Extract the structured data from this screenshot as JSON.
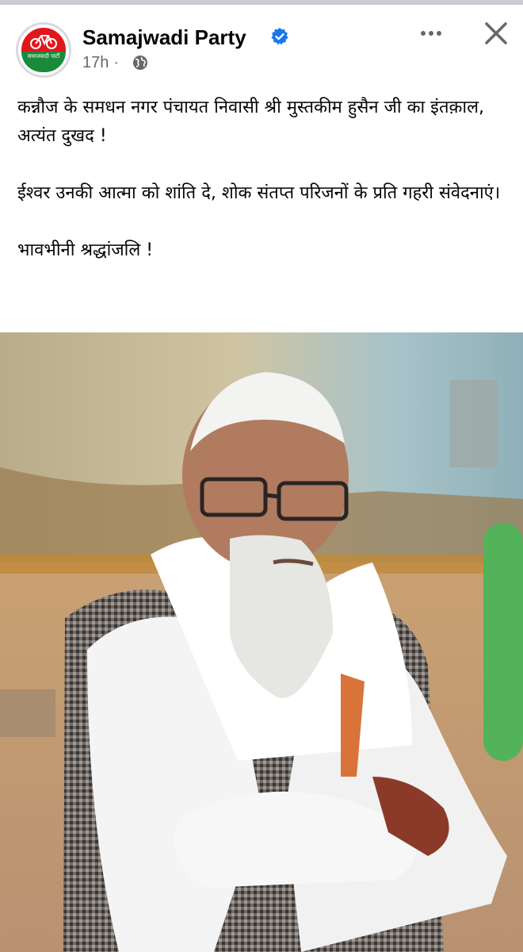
{
  "post": {
    "page_name": "Samajwadi Party",
    "avatar_label": "समाजवादी पार्टी",
    "time_ago": "17h",
    "dot": "·",
    "paragraphs": [
      "कन्नौज के समधन नगर पंचायत निवासी श्री मुस्तकीम हुसैन जी का इंतक़ाल, अत्यंत दुखद !",
      "ईश्वर उनकी आत्मा को शांति दे, शोक संतप्त परिजनों के प्रति गहरी संवेदनाएं।",
      "भावभीनी श्रद्धांजलि !"
    ]
  },
  "icons": {
    "verified": "verified-badge-icon",
    "audience": "globe-icon",
    "more": "more-options-icon",
    "close": "close-icon"
  },
  "colors": {
    "verified_blue": "#1877f2",
    "meta_gray": "#65676b",
    "party_red": "#e0161b",
    "party_green": "#1a8a3a"
  }
}
